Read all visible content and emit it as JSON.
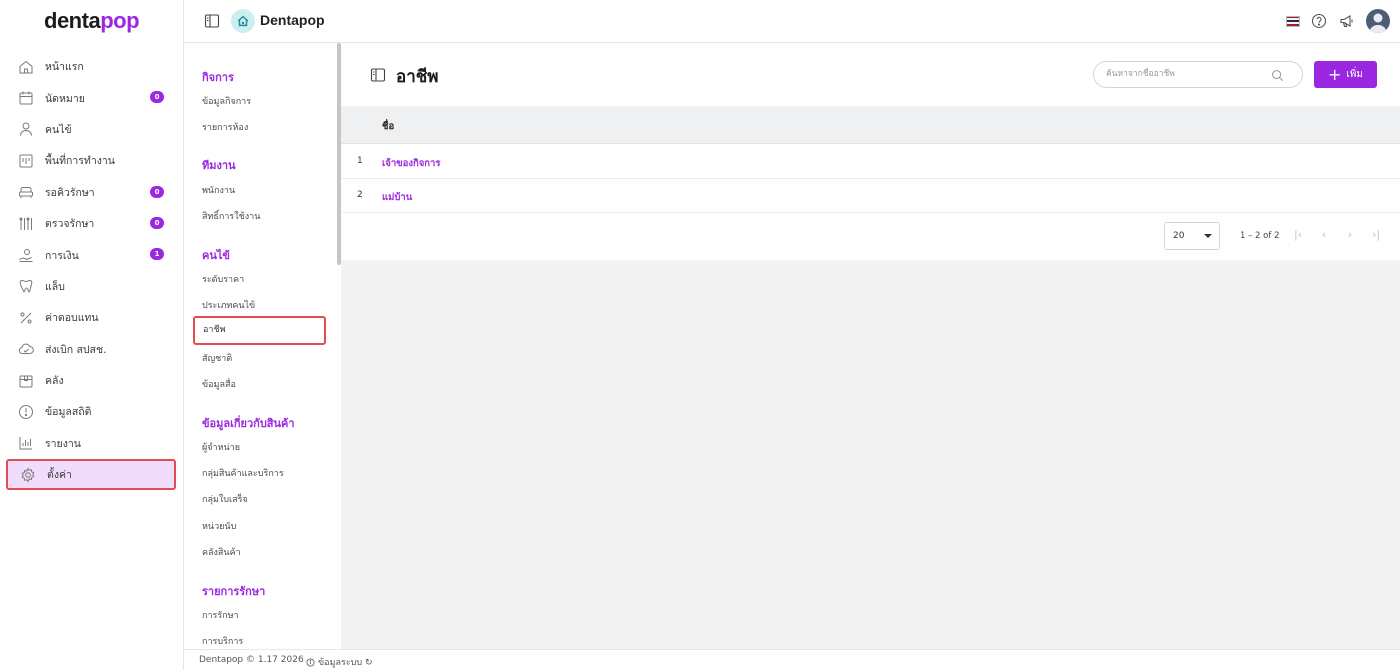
{
  "brand": {
    "logo_main": "denta",
    "logo_accent": "pop",
    "accent_color": "#9b27e0"
  },
  "topbar": {
    "title": "Dentapop",
    "icons": [
      "sidebar-toggle-icon",
      "home-icon",
      "thai-flag-icon",
      "help-icon",
      "megaphone-icon",
      "user-avatar"
    ]
  },
  "sidebar": {
    "items": [
      {
        "label": "หน้าแรก",
        "icon": "home-icon"
      },
      {
        "label": "นัดหมาย",
        "icon": "calendar-icon",
        "badge": "0"
      },
      {
        "label": "คนไข้",
        "icon": "user-icon"
      },
      {
        "label": "พื้นที่การทำงาน",
        "icon": "workspace-icon"
      },
      {
        "label": "รอคิวรักษา",
        "icon": "sofa-icon",
        "badge": "0"
      },
      {
        "label": "ตรวจรักษา",
        "icon": "tools-icon",
        "badge": "0"
      },
      {
        "label": "การเงิน",
        "icon": "cash-icon",
        "badge": "1"
      },
      {
        "label": "แล็บ",
        "icon": "tooth-icon"
      },
      {
        "label": "ค่าตอบแทน",
        "icon": "percent-icon"
      },
      {
        "label": "ส่งเบิก สปสช.",
        "icon": "cloud-icon"
      },
      {
        "label": "คลัง",
        "icon": "box-icon"
      },
      {
        "label": "ข้อมูลสถิติ",
        "icon": "stats-icon"
      },
      {
        "label": "รายงาน",
        "icon": "report-icon"
      },
      {
        "label": "ตั้งค่า",
        "icon": "gear-icon",
        "active": true
      }
    ]
  },
  "submenu": {
    "groups": [
      {
        "title": "กิจการ",
        "items": [
          "ข้อมูลกิจการ",
          "รายการห้อง"
        ]
      },
      {
        "title": "ทีมงาน",
        "items": [
          "พนักงาน",
          "สิทธิ์การใช้งาน"
        ]
      },
      {
        "title": "คนไข้",
        "items": [
          "ระดับราคา",
          "ประเภทคนไข้",
          "อาชีพ",
          "สัญชาติ",
          "ข้อมูลสื่อ"
        ]
      },
      {
        "title": "ข้อมูลเกี่ยวกับสินค้า",
        "items": [
          "ผู้จำหน่าย",
          "กลุ่มสินค้าและบริการ",
          "กลุ่มใบเสร็จ",
          "หน่วยนับ",
          "คลังสินค้า"
        ]
      },
      {
        "title": "รายการรักษา",
        "items": [
          "การรักษา",
          "การบริการ"
        ]
      }
    ],
    "active_item": "อาชีพ"
  },
  "main": {
    "title": "อาชีพ",
    "search_placeholder": "ค้นหาจากชื่ออาชีพ",
    "add_label": "เพิ่ม",
    "column_header": "ชื่อ",
    "rows": [
      {
        "num": "1",
        "name": "เจ้าของกิจการ"
      },
      {
        "num": "2",
        "name": "แม่บ้าน"
      }
    ],
    "pagination": {
      "page_size": "20",
      "range": "1 – 2 of 2"
    }
  },
  "footer": {
    "copyright": "Dentapop © 1.17 2026",
    "system_info": "ข้อมูลระบบ ↻"
  }
}
